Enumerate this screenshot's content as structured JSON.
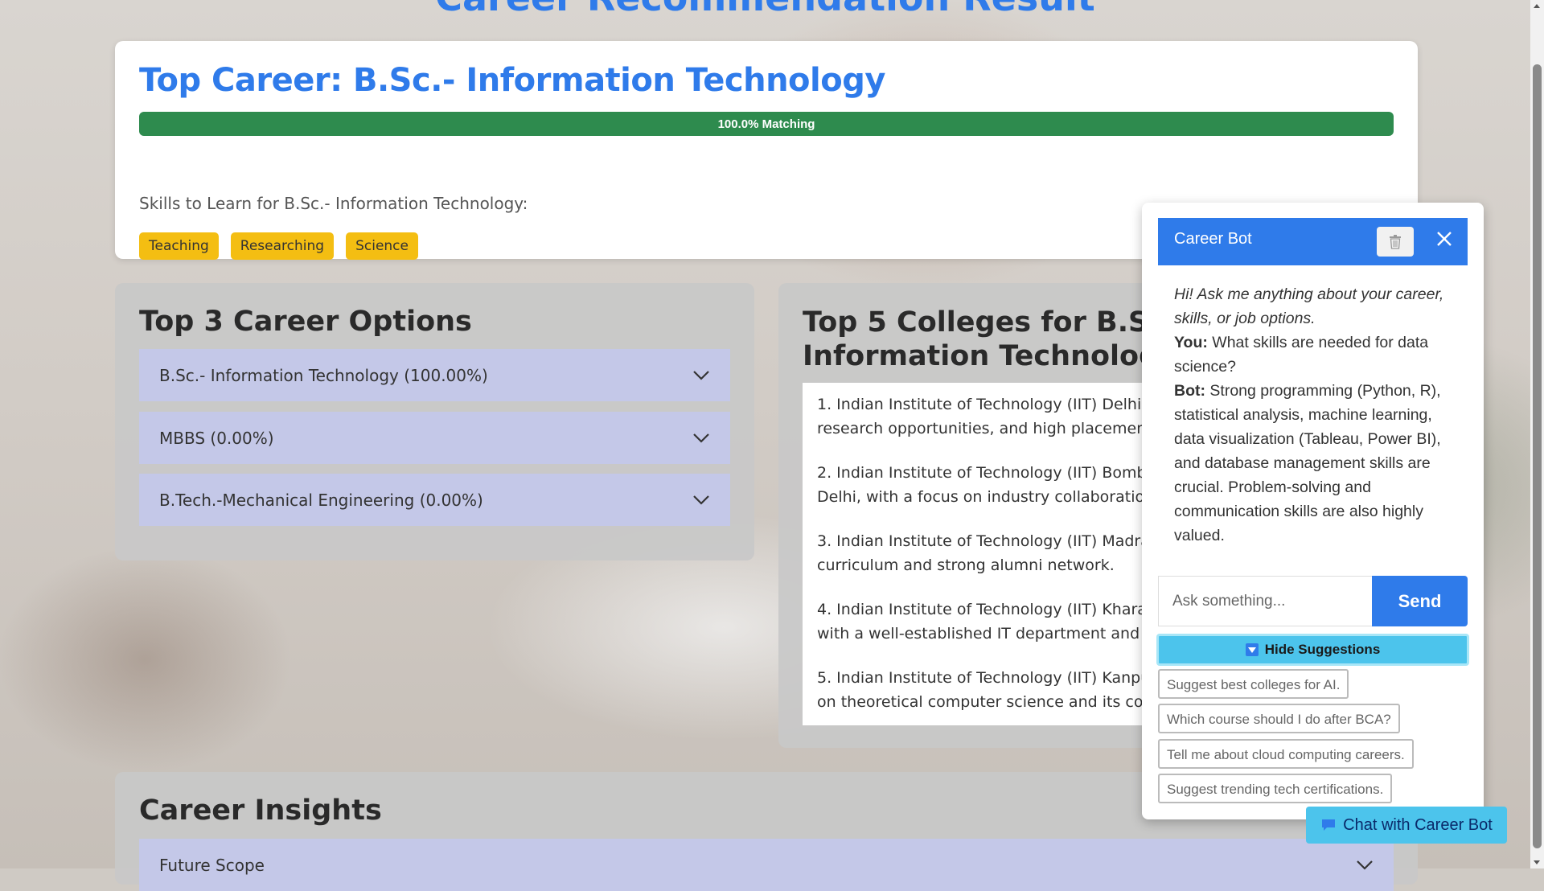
{
  "page": {
    "title": "Career Recommendation Result"
  },
  "top_career": {
    "heading": "Top Career: B.Sc.- Information Technology",
    "match_percent": 100,
    "match_label": "100.0% Matching",
    "skills_label": "Skills to Learn for B.Sc.- Information Technology:",
    "skills": [
      "Teaching",
      "Researching",
      "Science"
    ]
  },
  "career_options": {
    "heading": "Top 3 Career Options",
    "items": [
      {
        "label": "B.Sc.- Information Technology (100.00%)"
      },
      {
        "label": "MBBS (0.00%)"
      },
      {
        "label": "B.Tech.-Mechanical Engineering (0.00%)"
      }
    ]
  },
  "colleges": {
    "heading": "Top 5 Colleges for B.Sc.- Information Technology",
    "items": [
      {
        "line1": "1. Indian Institute of Technology (IIT) Delhi -",
        "line2": "research opportunities, and high placement"
      },
      {
        "line1": "2. Indian Institute of Technology (IIT) Bomba",
        "line2": "Delhi, with a focus on industry collaboratio"
      },
      {
        "line1": "3. Indian Institute of Technology (IIT) Madra",
        "line2": "curriculum and strong alumni network."
      },
      {
        "line1": "4. Indian Institute of Technology (IIT) Kharag",
        "line2": "with a well-established IT department and g"
      },
      {
        "line1": "5. Indian Institute of Technology (IIT) Kanpu",
        "line2": "on theoretical computer science and its con"
      }
    ]
  },
  "insights": {
    "heading": "Career Insights",
    "items": [
      {
        "label": "Future Scope"
      }
    ]
  },
  "chatbot": {
    "title": "Career Bot",
    "greeting": "Hi! Ask me anything about your career, skills, or job options.",
    "messages": [
      {
        "speaker": "You:",
        "text": " What skills are needed for data science?"
      },
      {
        "speaker": "Bot:",
        "text": " Strong programming (Python, R), statistical analysis, machine learning, data visualization (Tableau, Power BI), and database management skills are crucial. Problem-solving and communication skills are also highly valued."
      }
    ],
    "input_placeholder": "Ask something...",
    "send_label": "Send",
    "toggle_suggestions_label": "Hide Suggestions",
    "suggestions": [
      "Suggest best colleges for AI.",
      "Which course should I do after BCA?",
      "Tell me about cloud computing careers.",
      "Suggest trending tech certifications."
    ],
    "fab_label": "Chat with Career Bot"
  },
  "colors": {
    "accent": "#2f7bea",
    "match_bar": "#2e8b4e",
    "skill_tag": "#f4be12",
    "accordion": "#c4c8e8",
    "suggest_toggle": "#4cc4ec"
  },
  "icons": {
    "chevron": "chevron-down-icon",
    "trash": "trash-icon",
    "close": "close-icon",
    "chat": "speech-bubble-icon",
    "toggle": "triangle-down-icon"
  }
}
